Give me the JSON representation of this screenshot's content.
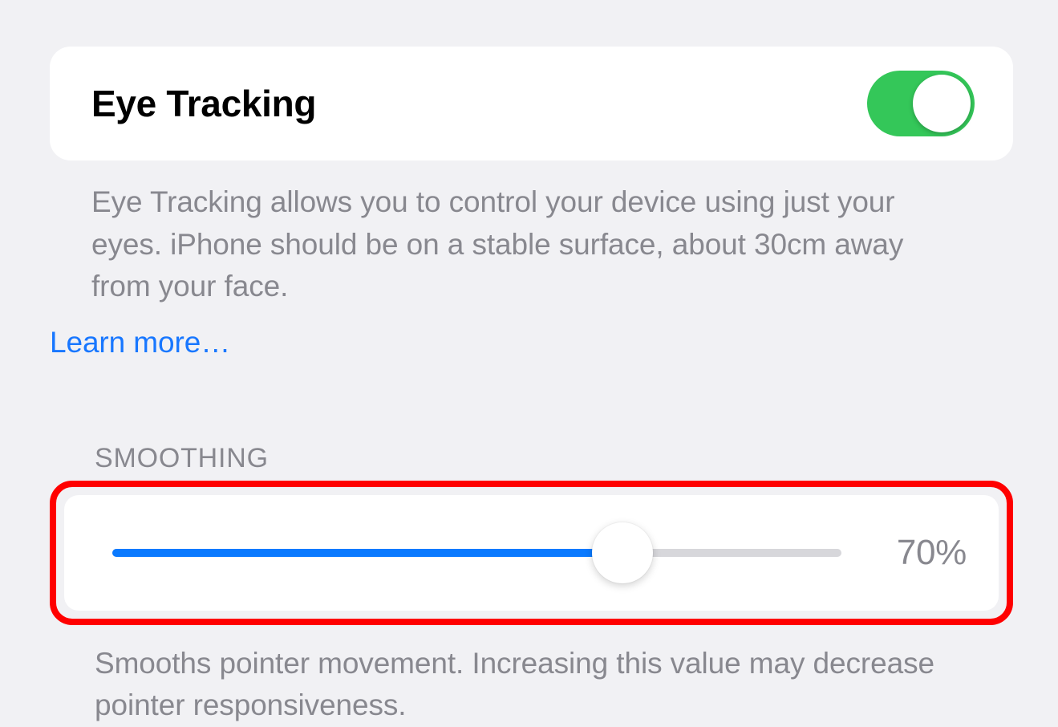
{
  "eye_tracking": {
    "title": "Eye Tracking",
    "enabled": true,
    "description": "Eye Tracking allows you to control your device using just your eyes. iPhone should be on a stable surface, about 30cm away from your face.",
    "learn_more": "Learn more…"
  },
  "smoothing": {
    "header": "SMOOTHING",
    "value_percent": 70,
    "value_label": "70%",
    "description": "Smooths pointer movement. Increasing this value may decrease pointer responsiveness."
  },
  "colors": {
    "toggle_on": "#34c759",
    "accent": "#0a7aff",
    "highlight": "#ff0000"
  }
}
